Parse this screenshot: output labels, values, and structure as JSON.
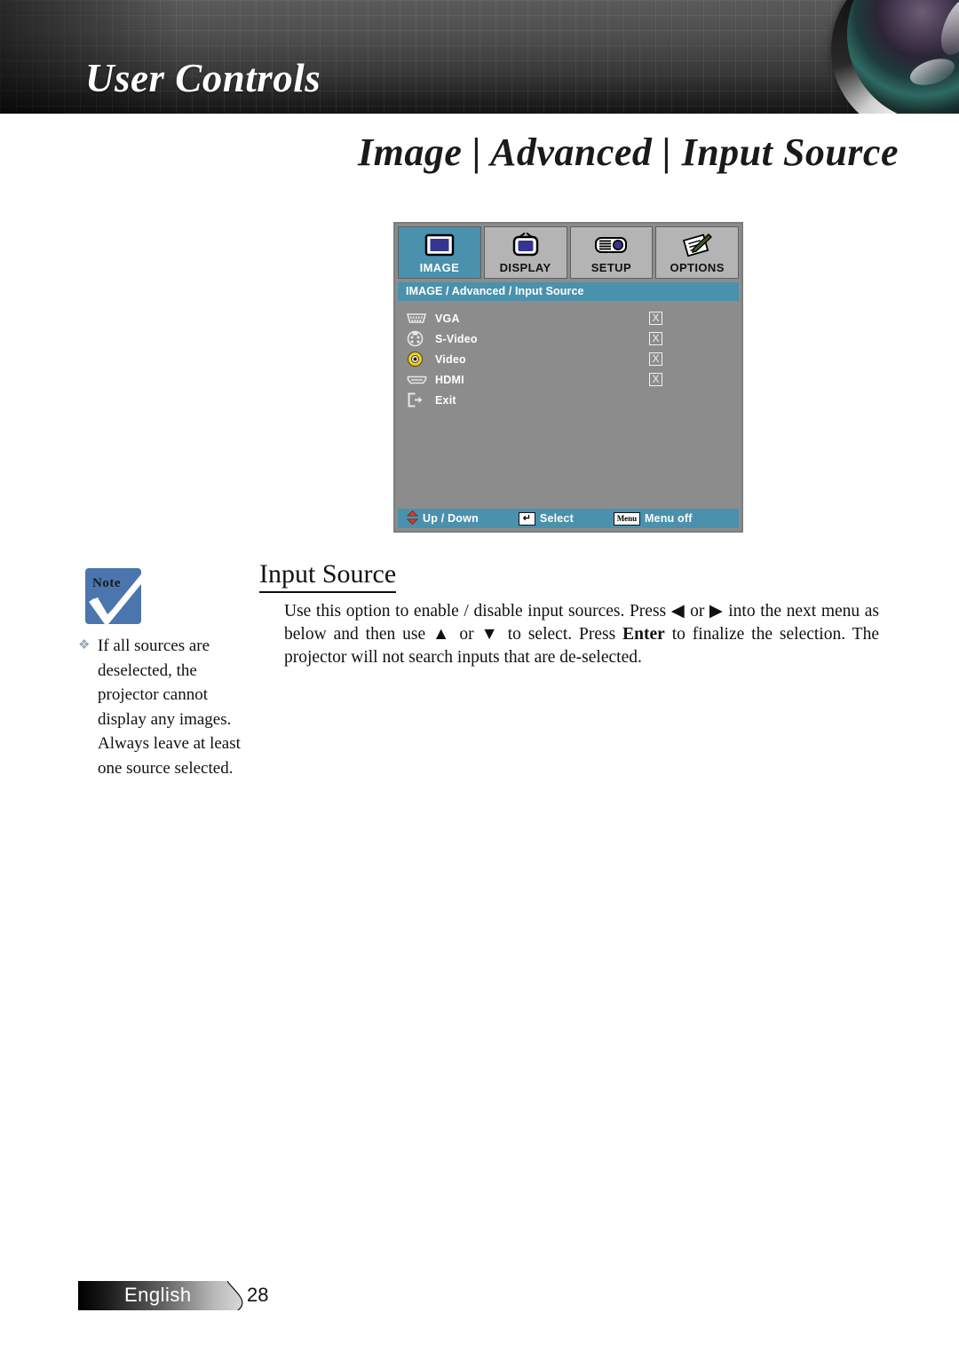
{
  "header": {
    "banner_title": "User Controls",
    "page_title": "Image | Advanced | Input Source",
    "lens_icon": "camera-lens-photo"
  },
  "osd": {
    "tabs": [
      {
        "label": "IMAGE",
        "icon": "image-screen-icon",
        "active": true
      },
      {
        "label": "DISPLAY",
        "icon": "television-icon",
        "active": false
      },
      {
        "label": "SETUP",
        "icon": "projector-icon",
        "active": false
      },
      {
        "label": "OPTIONS",
        "icon": "notepad-pencil-icon",
        "active": false
      }
    ],
    "breadcrumb": "IMAGE / Advanced / Input Source",
    "rows": [
      {
        "label": "VGA",
        "icon": "vga-connector-icon",
        "check": "X",
        "has_check": true
      },
      {
        "label": "S-Video",
        "icon": "svideo-connector-icon",
        "check": "X",
        "has_check": true
      },
      {
        "label": "Video",
        "icon": "rca-composite-icon",
        "check": "X",
        "has_check": true
      },
      {
        "label": "HDMI",
        "icon": "hdmi-connector-icon",
        "check": "X",
        "has_check": true
      },
      {
        "label": "Exit",
        "icon": "exit-arrow-icon",
        "check": "",
        "has_check": false
      }
    ],
    "status": {
      "updown_label": "Up / Down",
      "updown_icon": "up-down-arrows-icon",
      "select_key": "↵",
      "select_label": "Select",
      "menu_key": "Menu",
      "menu_label": "Menu off"
    },
    "colors": {
      "accent": "#4A91AD",
      "panel": "#8C8C8C",
      "tab_inactive": "#B4B4B4"
    }
  },
  "article": {
    "heading": "Input Source",
    "paragraph_part1": "Use this option to enable / disable input sources. Press ◀ or ▶ into the next menu as below and then use ▲ or ▼ to select. Press ",
    "paragraph_bold": "Enter",
    "paragraph_part2": " to finalize the selection. The projector will not search inputs that are de-selected."
  },
  "note": {
    "badge_word": "Note",
    "badge_icon": "note-checkmark-icon",
    "bullet": "❖",
    "text": "If all sources are deselected, the projector cannot display any images. Always leave at least one source selected."
  },
  "footer": {
    "language": "English",
    "page_number": "28"
  }
}
